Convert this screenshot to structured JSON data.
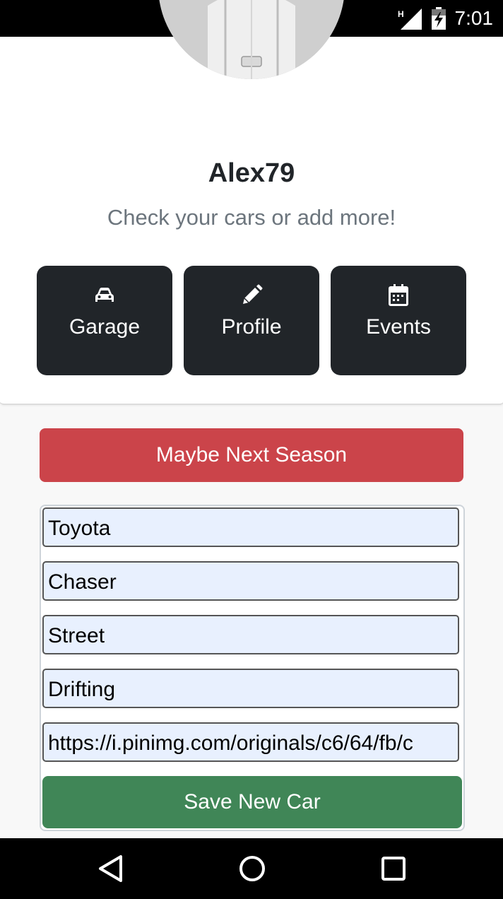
{
  "status_bar": {
    "time": "7:01",
    "network_label": "H",
    "icons": [
      "signal-icon",
      "battery-charging-icon"
    ]
  },
  "profile": {
    "username": "Alex79",
    "tagline": "Check your cars or add more!"
  },
  "tiles": [
    {
      "label": "Garage",
      "icon": "car-icon"
    },
    {
      "label": "Profile",
      "icon": "pencil-icon"
    },
    {
      "label": "Events",
      "icon": "calendar-icon"
    }
  ],
  "actions": {
    "cancel_label": "Maybe Next Season",
    "save_label": "Save New Car"
  },
  "form": {
    "fields": [
      {
        "name": "make",
        "value": "Toyota"
      },
      {
        "name": "model",
        "value": "Chaser"
      },
      {
        "name": "category",
        "value": "Street"
      },
      {
        "name": "discipline",
        "value": "Drifting"
      },
      {
        "name": "image_url",
        "value": "https://i.pinimg.com/originals/c6/64/fb/c"
      }
    ]
  },
  "nav": {
    "icons": [
      "back-icon",
      "home-icon",
      "recents-icon"
    ]
  },
  "colors": {
    "tile_bg": "#212529",
    "danger": "#cb444a",
    "success": "#408657",
    "field_bg": "#e8f0fe"
  }
}
